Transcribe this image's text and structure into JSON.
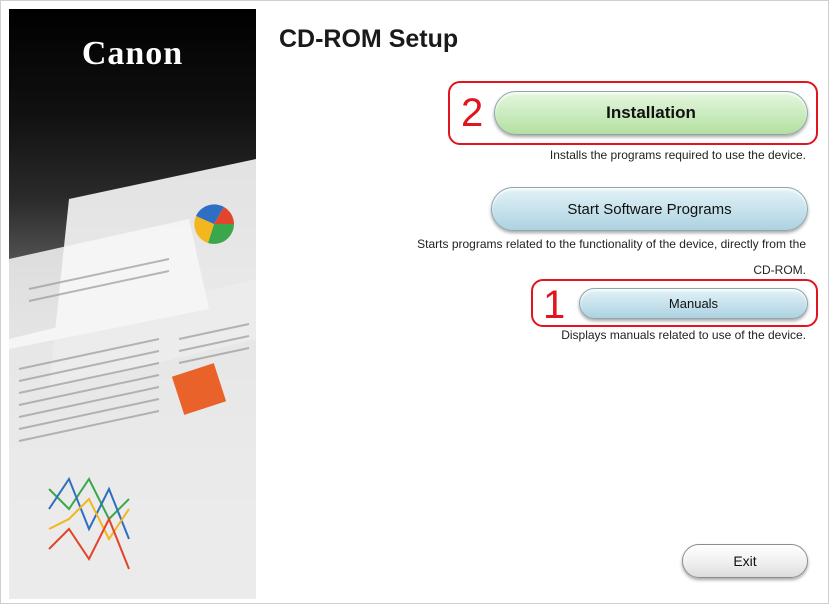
{
  "brand": {
    "logo_text": "Canon"
  },
  "window": {
    "title": "CD-ROM Setup"
  },
  "options": {
    "installation": {
      "label": "Installation",
      "description": "Installs the programs required to use the device."
    },
    "start_software": {
      "label": "Start Software Programs",
      "description_line1": "Starts programs related to the functionality of the device, directly from the",
      "description_line2": "CD-ROM."
    },
    "manuals": {
      "label": "Manuals",
      "description": "Displays manuals related to use of the device."
    }
  },
  "footer": {
    "exit_label": "Exit"
  },
  "callouts": {
    "installation_number": "2",
    "manuals_number": "1"
  },
  "colors": {
    "callout": "#e0151d",
    "installation_button": "#c9ebbd",
    "software_button": "#c5e1ec",
    "brand_panel": "#000000"
  }
}
